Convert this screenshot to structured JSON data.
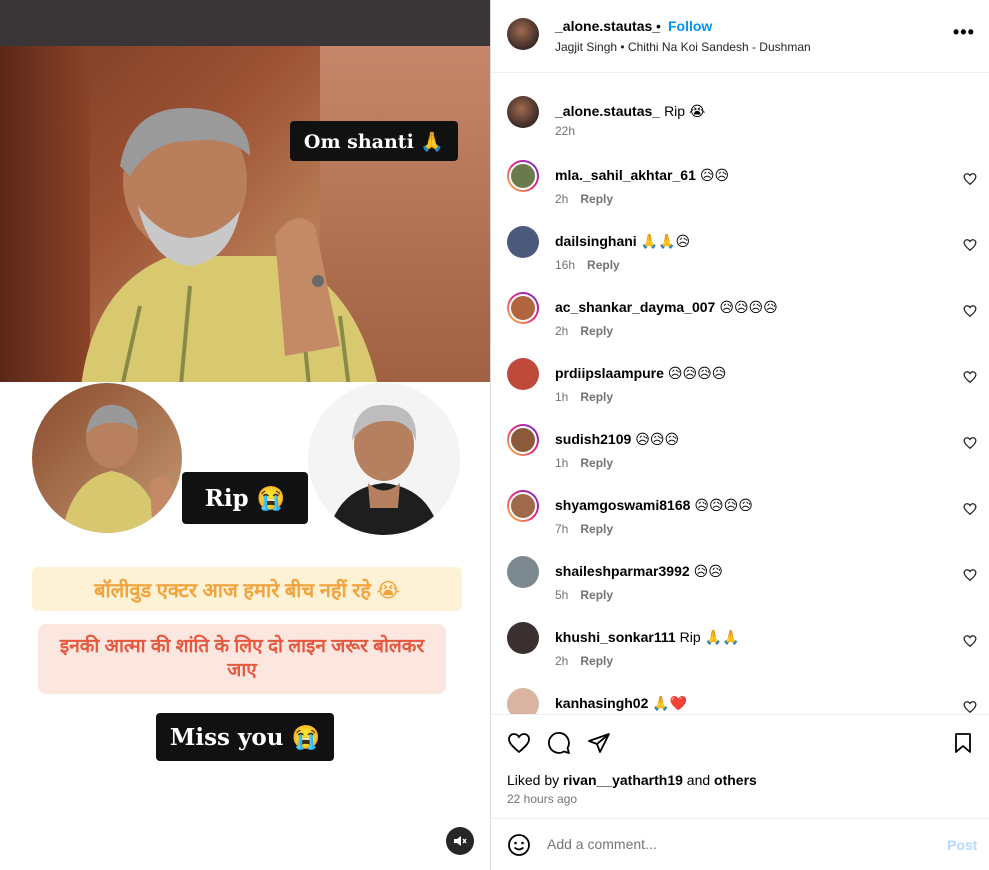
{
  "media": {
    "overlay_om": "Om shanti 🙏",
    "overlay_rip": "Rip 😭",
    "hindi_line1": "बॉलीवुड एक्टर आज हमारे बीच नहीं रहे 😭",
    "hindi_line2": "इनकी आत्मा की शांति के लिए दो लाइन जरूर बोलकर जाए",
    "overlay_miss": "Miss you 😭"
  },
  "header": {
    "username": "_alone.stautas_",
    "dot": "•",
    "follow_label": "Follow",
    "song": "Jagjit Singh • Chithi Na Koi Sandesh - Dushman",
    "more_label": "•••"
  },
  "caption": {
    "username": "_alone.stautas_",
    "text": "Rip 😭",
    "time": "22h"
  },
  "comments": [
    {
      "username": "mla._sahil_akhtar_61",
      "text": "😥😥",
      "time": "2h",
      "reply": "Reply",
      "ring": true,
      "color": "#6b7a4c"
    },
    {
      "username": "dailsinghani",
      "text": "🙏🙏😥",
      "time": "16h",
      "reply": "Reply",
      "ring": false,
      "color": "#4b5a7a"
    },
    {
      "username": "ac_shankar_dayma_007",
      "text": "😥😥😥😥",
      "time": "2h",
      "reply": "Reply",
      "ring": true,
      "color": "#b0643f"
    },
    {
      "username": "prdiipslaampure",
      "text": "😥😥😥😥",
      "time": "1h",
      "reply": "Reply",
      "ring": false,
      "color": "#c04a3a"
    },
    {
      "username": "sudish2109",
      "text": "😥😥😥",
      "time": "1h",
      "reply": "Reply",
      "ring": true,
      "color": "#8a5a3a"
    },
    {
      "username": "shyamgoswami8168",
      "text": "😥😥😥😥",
      "time": "7h",
      "reply": "Reply",
      "ring": true,
      "color": "#a06a4a"
    },
    {
      "username": "shaileshparmar3992",
      "text": "😥😥",
      "time": "5h",
      "reply": "Reply",
      "ring": false,
      "color": "#7c8a90"
    },
    {
      "username": "khushi_sonkar111",
      "text": "Rip 🙏🙏",
      "time": "2h",
      "reply": "Reply",
      "ring": false,
      "color": "#3a3030"
    },
    {
      "username": "kanhasingh02",
      "text": "🙏❤️",
      "time": "",
      "reply": "",
      "ring": false,
      "color": "#d9b4a0"
    }
  ],
  "likes": {
    "prefix": "Liked by",
    "user": "rivan__yatharth19",
    "and": "and",
    "others": "others",
    "time": "22 hours ago"
  },
  "add_comment": {
    "placeholder": "Add a comment...",
    "post_label": "Post"
  }
}
